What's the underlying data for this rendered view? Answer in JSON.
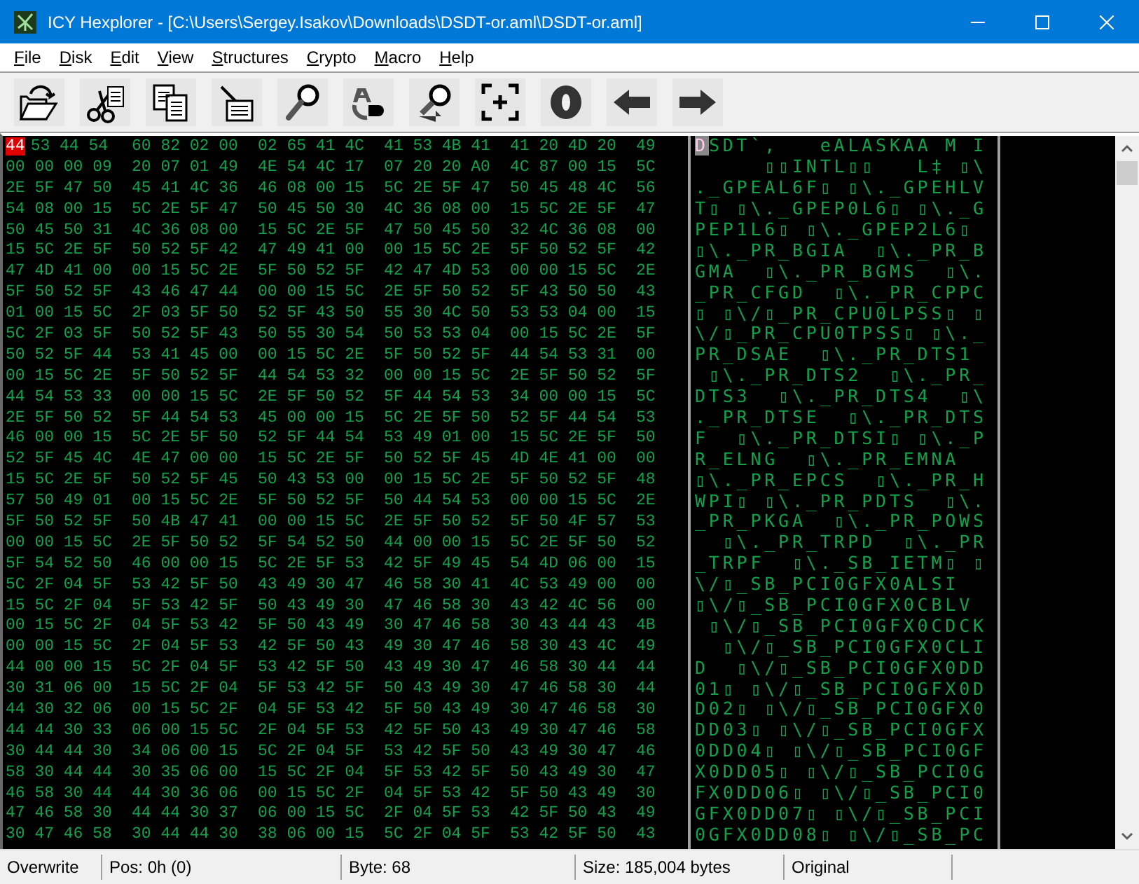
{
  "window": {
    "title": "ICY Hexplorer - [C:\\Users\\Sergey.Isakov\\Downloads\\DSDT-or.aml\\DSDT-or.aml]"
  },
  "menu": [
    "File",
    "Disk",
    "Edit",
    "View",
    "Structures",
    "Crypto",
    "Macro",
    "Help"
  ],
  "hex_view": {
    "rows": [
      {
        "cursor_hex": "44",
        "cursor_char": "D",
        "hex": [
          "53 44 54",
          "60 82 02 00",
          "02 65 41 4C",
          "41 53 4B 41",
          "41 20 4D 20",
          "49"
        ],
        "ascii": "SDT`,   eALASKAA M I"
      },
      {
        "hex": [
          "00 00 00 09",
          "20 07 01 49",
          "4E 54 4C 17",
          "07 20 20 A0",
          "4C 87 00 15",
          "5C"
        ],
        "ascii": "     ▯▯INTL▯▯   L‡ ▯\\"
      },
      {
        "hex": [
          "2E 5F 47 50",
          "45 41 4C 36",
          "46 08 00 15",
          "5C 2E 5F 47",
          "50 45 48 4C",
          "56"
        ],
        "ascii": "._GPEAL6F▯ ▯\\._GPEHLV"
      },
      {
        "hex": [
          "54 08 00 15",
          "5C 2E 5F 47",
          "50 45 50 30",
          "4C 36 08 00",
          "15 5C 2E 5F",
          "47"
        ],
        "ascii": "T▯ ▯\\._GPEP0L6▯ ▯\\._G"
      },
      {
        "hex": [
          "50 45 50 31",
          "4C 36 08 00",
          "15 5C 2E 5F",
          "47 50 45 50",
          "32 4C 36 08",
          "00"
        ],
        "ascii": "PEP1L6▯ ▯\\._GPEP2L6▯ "
      },
      {
        "hex": [
          "15 5C 2E 5F",
          "50 52 5F 42",
          "47 49 41 00",
          "00 15 5C 2E",
          "5F 50 52 5F",
          "42"
        ],
        "ascii": "▯\\._PR_BGIA  ▯\\._PR_B"
      },
      {
        "hex": [
          "47 4D 41 00",
          "00 15 5C 2E",
          "5F 50 52 5F",
          "42 47 4D 53",
          "00 00 15 5C",
          "2E"
        ],
        "ascii": "GMA  ▯\\._PR_BGMS  ▯\\."
      },
      {
        "hex": [
          "5F 50 52 5F",
          "43 46 47 44",
          "00 00 15 5C",
          "2E 5F 50 52",
          "5F 43 50 50",
          "43"
        ],
        "ascii": "_PR_CFGD  ▯\\._PR_CPPC"
      },
      {
        "hex": [
          "01 00 15 5C",
          "2F 03 5F 50",
          "52 5F 43 50",
          "55 30 4C 50",
          "53 53 04 00",
          "15"
        ],
        "ascii": "▯ ▯\\/▯_PR_CPU0LPSS▯ ▯"
      },
      {
        "hex": [
          "5C 2F 03 5F",
          "50 52 5F 43",
          "50 55 30 54",
          "50 53 53 04",
          "00 15 5C 2E",
          "5F"
        ],
        "ascii": "\\/▯_PR_CPU0TPSS▯ ▯\\._"
      },
      {
        "hex": [
          "50 52 5F 44",
          "53 41 45 00",
          "00 15 5C 2E",
          "5F 50 52 5F",
          "44 54 53 31",
          "00"
        ],
        "ascii": "PR_DSAE  ▯\\._PR_DTS1 "
      },
      {
        "hex": [
          "00 15 5C 2E",
          "5F 50 52 5F",
          "44 54 53 32",
          "00 00 15 5C",
          "2E 5F 50 52",
          "5F"
        ],
        "ascii": " ▯\\._PR_DTS2  ▯\\._PR_"
      },
      {
        "hex": [
          "44 54 53 33",
          "00 00 15 5C",
          "2E 5F 50 52",
          "5F 44 54 53",
          "34 00 00 15",
          "5C"
        ],
        "ascii": "DTS3  ▯\\._PR_DTS4  ▯\\"
      },
      {
        "hex": [
          "2E 5F 50 52",
          "5F 44 54 53",
          "45 00 00 15",
          "5C 2E 5F 50",
          "52 5F 44 54",
          "53"
        ],
        "ascii": "._PR_DTSE  ▯\\._PR_DTS"
      },
      {
        "hex": [
          "46 00 00 15",
          "5C 2E 5F 50",
          "52 5F 44 54",
          "53 49 01 00",
          "15 5C 2E 5F",
          "50"
        ],
        "ascii": "F  ▯\\._PR_DTSI▯ ▯\\._P"
      },
      {
        "hex": [
          "52 5F 45 4C",
          "4E 47 00 00",
          "15 5C 2E 5F",
          "50 52 5F 45",
          "4D 4E 41 00",
          "00"
        ],
        "ascii": "R_ELNG  ▯\\._PR_EMNA  "
      },
      {
        "hex": [
          "15 5C 2E 5F",
          "50 52 5F 45",
          "50 43 53 00",
          "00 15 5C 2E",
          "5F 50 52 5F",
          "48"
        ],
        "ascii": "▯\\._PR_EPCS  ▯\\._PR_H"
      },
      {
        "hex": [
          "57 50 49 01",
          "00 15 5C 2E",
          "5F 50 52 5F",
          "50 44 54 53",
          "00 00 15 5C",
          "2E"
        ],
        "ascii": "WPI▯ ▯\\._PR_PDTS  ▯\\."
      },
      {
        "hex": [
          "5F 50 52 5F",
          "50 4B 47 41",
          "00 00 15 5C",
          "2E 5F 50 52",
          "5F 50 4F 57",
          "53"
        ],
        "ascii": "_PR_PKGA  ▯\\._PR_POWS"
      },
      {
        "hex": [
          "00 00 15 5C",
          "2E 5F 50 52",
          "5F 54 52 50",
          "44 00 00 15",
          "5C 2E 5F 50",
          "52"
        ],
        "ascii": "  ▯\\._PR_TRPD  ▯\\._PR"
      },
      {
        "hex": [
          "5F 54 52 50",
          "46 00 00 15",
          "5C 2E 5F 53",
          "42 5F 49 45",
          "54 4D 06 00",
          "15"
        ],
        "ascii": "_TRPF  ▯\\._SB_IETM▯ ▯"
      },
      {
        "hex": [
          "5C 2F 04 5F",
          "53 42 5F 50",
          "43 49 30 47",
          "46 58 30 41",
          "4C 53 49 00",
          "00"
        ],
        "ascii": "\\/▯_SB_PCI0GFX0ALSI  "
      },
      {
        "hex": [
          "15 5C 2F 04",
          "5F 53 42 5F",
          "50 43 49 30",
          "47 46 58 30",
          "43 42 4C 56",
          "00"
        ],
        "ascii": "▯\\/▯_SB_PCI0GFX0CBLV "
      },
      {
        "hex": [
          "00 15 5C 2F",
          "04 5F 53 42",
          "5F 50 43 49",
          "30 47 46 58",
          "30 43 44 43",
          "4B"
        ],
        "ascii": " ▯\\/▯_SB_PCI0GFX0CDCK"
      },
      {
        "hex": [
          "00 00 15 5C",
          "2F 04 5F 53",
          "42 5F 50 43",
          "49 30 47 46",
          "58 30 43 4C",
          "49"
        ],
        "ascii": "  ▯\\/▯_SB_PCI0GFX0CLI"
      },
      {
        "hex": [
          "44 00 00 15",
          "5C 2F 04 5F",
          "53 42 5F 50",
          "43 49 30 47",
          "46 58 30 44",
          "44"
        ],
        "ascii": "D  ▯\\/▯_SB_PCI0GFX0DD"
      },
      {
        "hex": [
          "30 31 06 00",
          "15 5C 2F 04",
          "5F 53 42 5F",
          "50 43 49 30",
          "47 46 58 30",
          "44"
        ],
        "ascii": "01▯ ▯\\/▯_SB_PCI0GFX0D"
      },
      {
        "hex": [
          "44 30 32 06",
          "00 15 5C 2F",
          "04 5F 53 42",
          "5F 50 43 49",
          "30 47 46 58",
          "30"
        ],
        "ascii": "D02▯ ▯\\/▯_SB_PCI0GFX0"
      },
      {
        "hex": [
          "44 44 30 33",
          "06 00 15 5C",
          "2F 04 5F 53",
          "42 5F 50 43",
          "49 30 47 46",
          "58"
        ],
        "ascii": "DD03▯ ▯\\/▯_SB_PCI0GFX"
      },
      {
        "hex": [
          "30 44 44 30",
          "34 06 00 15",
          "5C 2F 04 5F",
          "53 42 5F 50",
          "43 49 30 47",
          "46"
        ],
        "ascii": "0DD04▯ ▯\\/▯_SB_PCI0GF"
      },
      {
        "hex": [
          "58 30 44 44",
          "30 35 06 00",
          "15 5C 2F 04",
          "5F 53 42 5F",
          "50 43 49 30",
          "47"
        ],
        "ascii": "X0DD05▯ ▯\\/▯_SB_PCI0G"
      },
      {
        "hex": [
          "46 58 30 44",
          "44 30 36 06",
          "00 15 5C 2F",
          "04 5F 53 42",
          "5F 50 43 49",
          "30"
        ],
        "ascii": "FX0DD06▯ ▯\\/▯_SB_PCI0"
      },
      {
        "hex": [
          "47 46 58 30",
          "44 44 30 37",
          "06 00 15 5C",
          "2F 04 5F 53",
          "42 5F 50 43",
          "49"
        ],
        "ascii": "GFX0DD07▯ ▯\\/▯_SB_PCI"
      },
      {
        "hex": [
          "30 47 46 58",
          "30 44 44 30",
          "38 06 00 15",
          "5C 2F 04 5F",
          "53 42 5F 50",
          "43"
        ],
        "ascii": "0GFX0DD08▯ ▯\\/▯_SB_PC"
      }
    ]
  },
  "status_bar": [
    "Overwrite",
    "Pos: 0h (0)",
    "Byte: 68",
    "Size: 185,004 bytes",
    "Original"
  ]
}
